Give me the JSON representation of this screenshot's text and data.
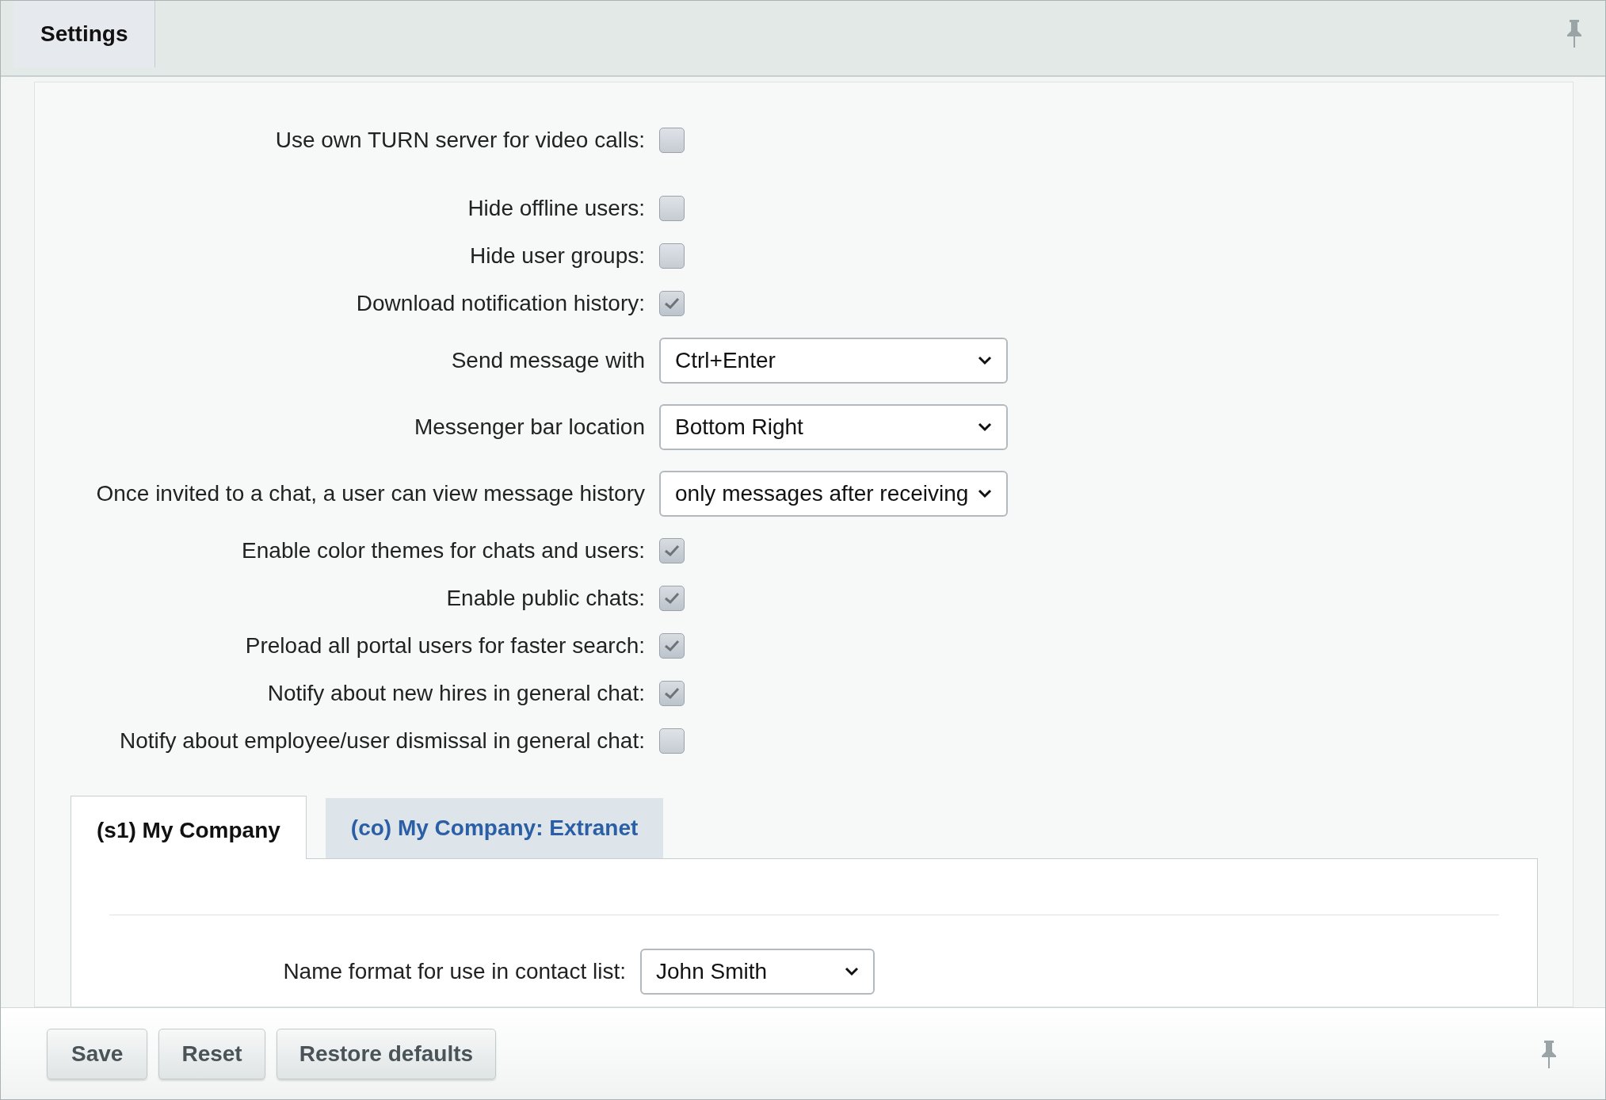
{
  "header": {
    "tab": "Settings"
  },
  "settings": [
    {
      "kind": "checkbox",
      "label": "Use own TURN server for video calls:",
      "checked": false
    },
    {
      "kind": "checkbox",
      "label": "Hide offline users:",
      "checked": false
    },
    {
      "kind": "checkbox",
      "label": "Hide user groups:",
      "checked": false
    },
    {
      "kind": "checkbox",
      "label": "Download notification history:",
      "checked": true
    },
    {
      "kind": "select",
      "label": "Send message with",
      "value": "Ctrl+Enter"
    },
    {
      "kind": "select",
      "label": "Messenger bar location",
      "value": "Bottom Right"
    },
    {
      "kind": "select",
      "label": "Once invited to a chat, a user can view message history",
      "value": "only messages after receiving"
    },
    {
      "kind": "checkbox",
      "label": "Enable color themes for chats and users:",
      "checked": true
    },
    {
      "kind": "checkbox",
      "label": "Enable public chats:",
      "checked": true
    },
    {
      "kind": "checkbox",
      "label": "Preload all portal users for faster search:",
      "checked": true
    },
    {
      "kind": "checkbox",
      "label": "Notify about new hires in general chat:",
      "checked": true
    },
    {
      "kind": "checkbox",
      "label": "Notify about employee/user dismissal in general chat:",
      "checked": false
    }
  ],
  "site_tabs": [
    {
      "label": "(s1) My Company",
      "selected": true
    },
    {
      "label": "(co) My Company: Extranet",
      "selected": false
    }
  ],
  "site_settings": [
    {
      "kind": "select",
      "label": "Name format for use in contact list:",
      "value": "John Smith"
    }
  ],
  "buttons": [
    "Save",
    "Reset",
    "Restore defaults"
  ]
}
